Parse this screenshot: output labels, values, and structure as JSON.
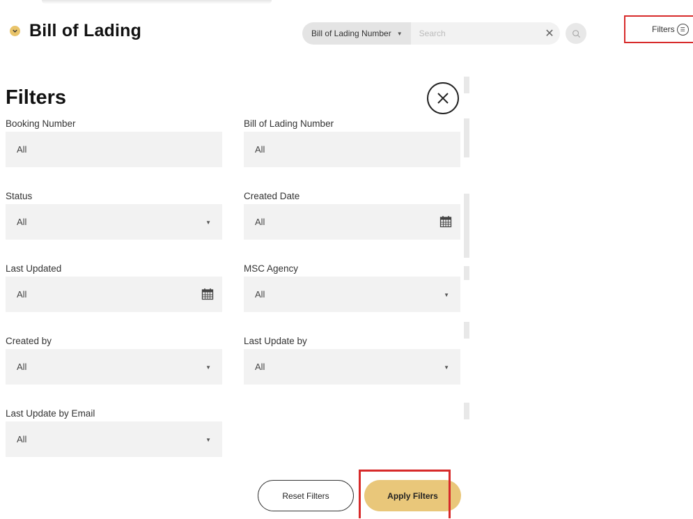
{
  "header": {
    "title": "Bill of Lading",
    "search_type": "Bill of Lading Number",
    "search_placeholder": "Search",
    "filters_label": "Filters"
  },
  "filters": {
    "heading": "Filters",
    "fields": [
      {
        "label": "Booking Number",
        "value": "All",
        "kind": "text"
      },
      {
        "label": "Bill of Lading Number",
        "value": "All",
        "kind": "text"
      },
      {
        "label": "Status",
        "value": "All",
        "kind": "dropdown"
      },
      {
        "label": "Created Date",
        "value": "All",
        "kind": "date"
      },
      {
        "label": "Last Updated",
        "value": "All",
        "kind": "date"
      },
      {
        "label": "MSC Agency",
        "value": "All",
        "kind": "dropdown"
      },
      {
        "label": "Created by",
        "value": "All",
        "kind": "dropdown"
      },
      {
        "label": "Last Update by",
        "value": "All",
        "kind": "dropdown"
      },
      {
        "label": "Last Update by Email",
        "value": "All",
        "kind": "dropdown"
      }
    ],
    "reset_label": "Reset Filters",
    "apply_label": "Apply Filters"
  },
  "colors": {
    "accent": "#e9c77a",
    "highlight": "#d72a2a"
  }
}
